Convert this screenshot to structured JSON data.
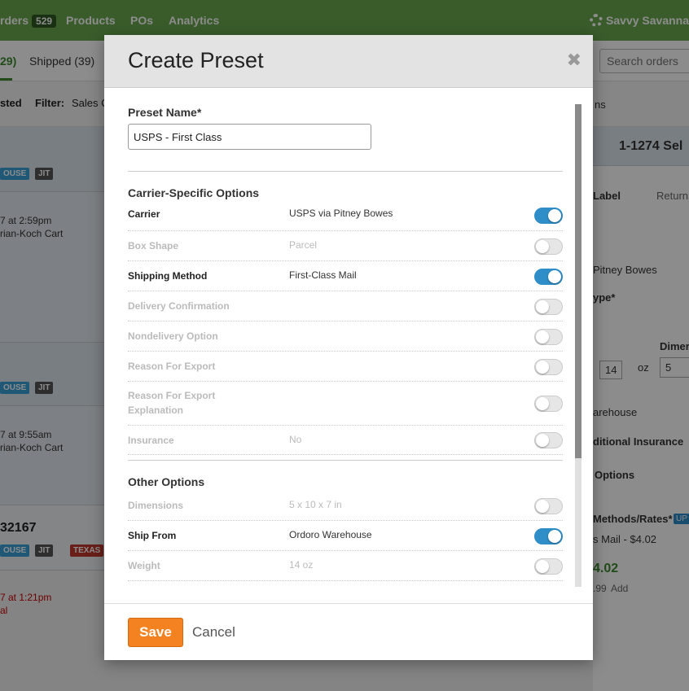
{
  "topbar": {
    "orders_label": "rders",
    "orders_count": "529",
    "products_label": "Products",
    "pos_label": "POs",
    "analytics_label": "Analytics",
    "user_label": "Savvy Savanna"
  },
  "tabs": {
    "awaiting_count": "29)",
    "shipped_label": "Shipped (39)"
  },
  "search": {
    "placeholder": "Search orders"
  },
  "filterbar": {
    "sort_label": "sted",
    "filter_label": "Filter:",
    "filter_value": "Sales C"
  },
  "orders": [
    {
      "tags": [
        "ouse",
        "JIT"
      ],
      "date": "7 at 2:59pm",
      "cart": "rian-Koch Cart"
    },
    {
      "tags": [
        "ouse",
        "JIT"
      ],
      "date": "7 at 9:55am",
      "cart": "rian-Koch Cart"
    },
    {
      "number": "32167",
      "tags": [
        "ouse",
        "JIT",
        "TEXAS"
      ],
      "date": "7 at 1:21pm",
      "extra": "al"
    }
  ],
  "right_panel": {
    "header": "1-1274 Sel",
    "options_top": "ns",
    "tab_label": "Label",
    "tab_return": "Return",
    "carrier": "Pitney Bowes",
    "type_label": "ype*",
    "dimensions_label": "Dimer",
    "weight_oz": "14",
    "oz_unit": "oz",
    "dim_value": "5",
    "warehouse": "arehouse",
    "insurance": "ditional Insurance",
    "options": "Options",
    "methods_label": "Methods/Rates*",
    "methods_badge": "UP",
    "rate": "s Mail - $4.02",
    "price": "4.02",
    "sub_price": ".99",
    "add_label": "Add"
  },
  "modal": {
    "title": "Create Preset",
    "close_icon": "close-icon",
    "preset_name_label": "Preset Name*",
    "preset_name_value": "USPS - First Class",
    "carrier_section_title": "Carrier-Specific Options",
    "carrier_options": [
      {
        "name": "Carrier",
        "value": "USPS via Pitney Bowes",
        "enabled": true
      },
      {
        "name": "Box Shape",
        "value": "Parcel",
        "enabled": false
      },
      {
        "name": "Shipping Method",
        "value": "First-Class Mail",
        "enabled": true
      },
      {
        "name": "Delivery Confirmation",
        "value": "",
        "enabled": false
      },
      {
        "name": "Nondelivery Option",
        "value": "",
        "enabled": false
      },
      {
        "name": "Reason For Export",
        "value": "",
        "enabled": false
      },
      {
        "name": "Reason For Export Explanation",
        "value": "",
        "enabled": false
      },
      {
        "name": "Insurance",
        "value": "No",
        "enabled": false
      }
    ],
    "other_section_title": "Other Options",
    "other_options": [
      {
        "name": "Dimensions",
        "value": "5 x 10 x 7 in",
        "enabled": false
      },
      {
        "name": "Ship From",
        "value": "Ordoro Warehouse",
        "enabled": true
      },
      {
        "name": "Weight",
        "value": "14 oz",
        "enabled": false
      }
    ],
    "save_label": "Save",
    "cancel_label": "Cancel"
  },
  "colors": {
    "topbar": "#6aa84f",
    "toggle_on": "#2f8dc7",
    "save_button": "#f58220"
  }
}
